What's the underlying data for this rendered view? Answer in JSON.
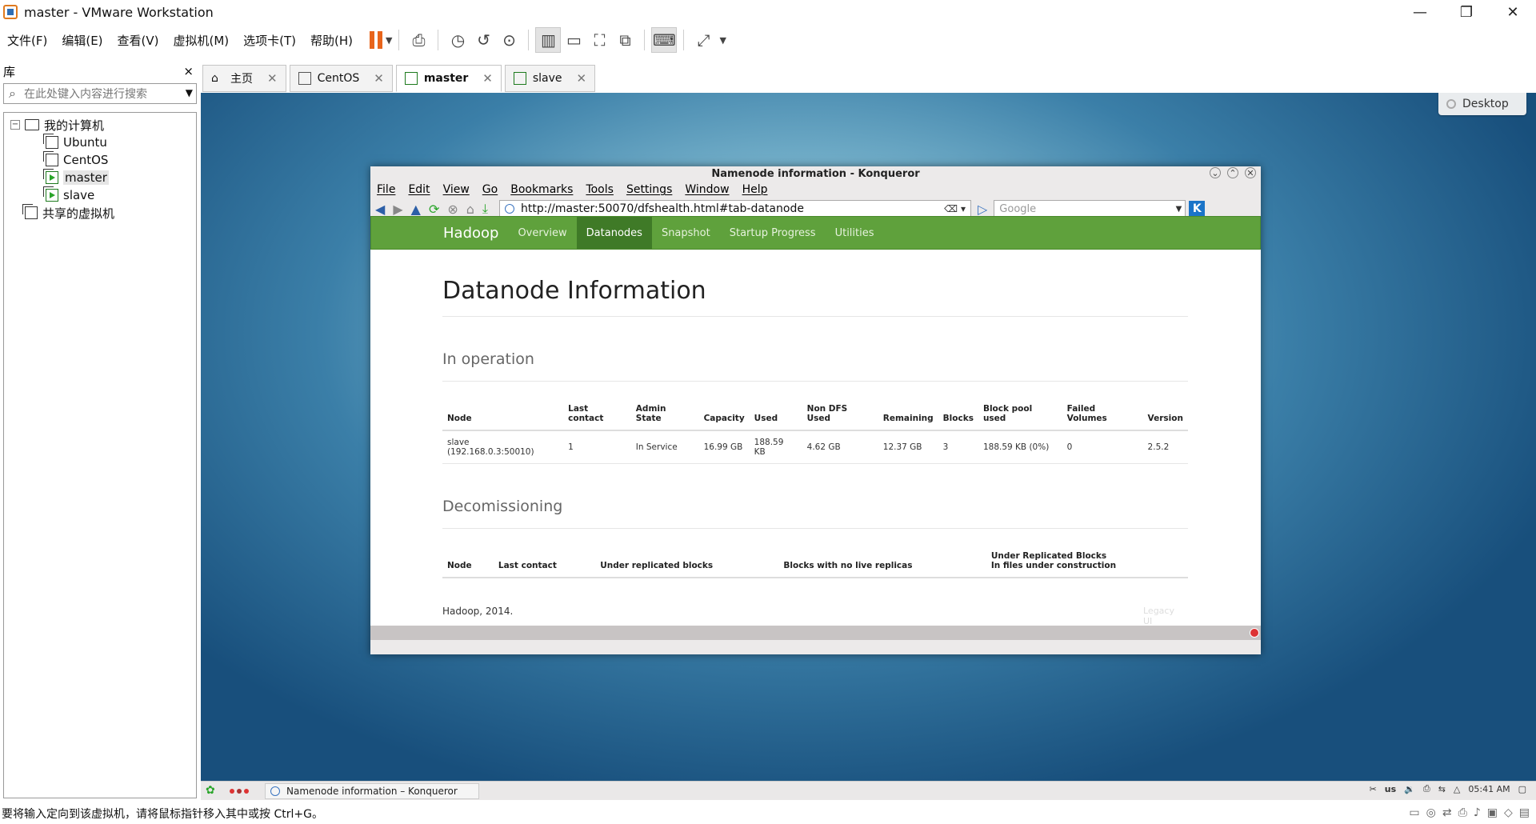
{
  "window": {
    "title": "master - VMware Workstation"
  },
  "menu": [
    "文件(F)",
    "编辑(E)",
    "查看(V)",
    "虚拟机(M)",
    "选项卡(T)",
    "帮助(H)"
  ],
  "library": {
    "title": "库",
    "close": "×",
    "search_placeholder": "在此处键入内容进行搜索",
    "root": "我的计算机",
    "vms": [
      "Ubuntu",
      "CentOS",
      "master",
      "slave"
    ],
    "shared": "共享的虚拟机"
  },
  "tabs": [
    {
      "label": "主页"
    },
    {
      "label": "CentOS"
    },
    {
      "label": "master"
    },
    {
      "label": "slave"
    }
  ],
  "guest": {
    "desktop_button": "Desktop",
    "browser": {
      "title": "Namenode information - Konqueror",
      "menu": [
        "File",
        "Edit",
        "View",
        "Go",
        "Bookmarks",
        "Tools",
        "Settings",
        "Window",
        "Help"
      ],
      "url": "http://master:50070/dfshealth.html#tab-datanode",
      "search_placeholder": "Google"
    },
    "page": {
      "brand": "Hadoop",
      "nav": [
        "Overview",
        "Datanodes",
        "Snapshot",
        "Startup Progress",
        "Utilities"
      ],
      "heading": "Datanode Information",
      "in_operation": {
        "title": "In operation",
        "columns": [
          "Node",
          "Last contact",
          "Admin State",
          "Capacity",
          "Used",
          "Non DFS Used",
          "Remaining",
          "Blocks",
          "Block pool used",
          "Failed Volumes",
          "Version"
        ],
        "rows": [
          [
            "slave (192.168.0.3:50010)",
            "1",
            "In Service",
            "16.99 GB",
            "188.59 KB",
            "4.62 GB",
            "12.37 GB",
            "3",
            "188.59 KB (0%)",
            "0",
            "2.5.2"
          ]
        ]
      },
      "decommissioning": {
        "title": "Decomissioning",
        "columns": [
          "Node",
          "Last contact",
          "Under replicated blocks",
          "Blocks with no live replicas",
          "Under Replicated Blocks",
          "In files under construction"
        ]
      },
      "footer": "Hadoop, 2014.",
      "legacy": "Legacy UI"
    },
    "taskbar": {
      "task": "Namenode information – Konqueror",
      "kbd": "us",
      "clock": "05:41 AM"
    }
  },
  "status": {
    "hint": "要将输入定向到该虚拟机，请将鼠标指针移入其中或按 Ctrl+G。"
  }
}
